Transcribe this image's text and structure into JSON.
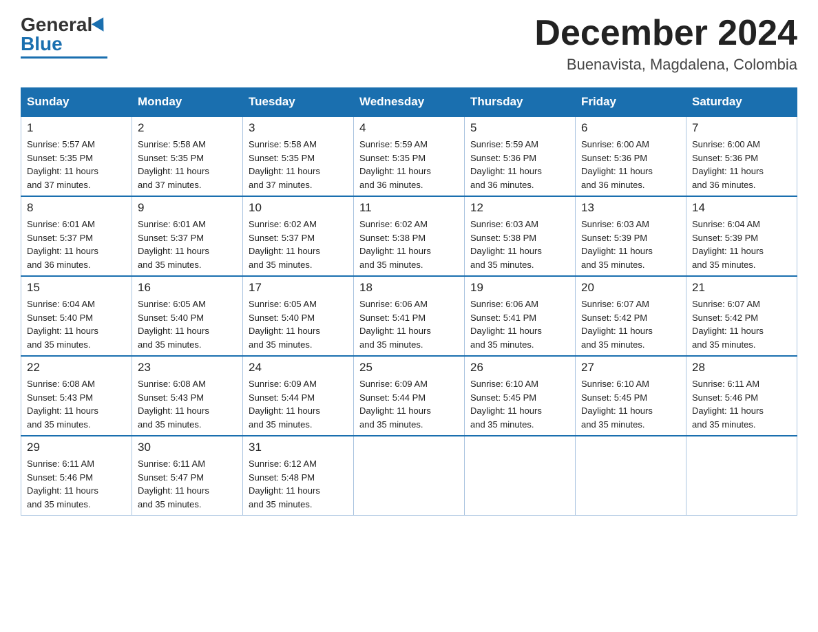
{
  "logo": {
    "general": "General",
    "blue": "Blue"
  },
  "title": "December 2024",
  "subtitle": "Buenavista, Magdalena, Colombia",
  "days_header": [
    "Sunday",
    "Monday",
    "Tuesday",
    "Wednesday",
    "Thursday",
    "Friday",
    "Saturday"
  ],
  "weeks": [
    [
      {
        "day": "1",
        "info": "Sunrise: 5:57 AM\nSunset: 5:35 PM\nDaylight: 11 hours\nand 37 minutes."
      },
      {
        "day": "2",
        "info": "Sunrise: 5:58 AM\nSunset: 5:35 PM\nDaylight: 11 hours\nand 37 minutes."
      },
      {
        "day": "3",
        "info": "Sunrise: 5:58 AM\nSunset: 5:35 PM\nDaylight: 11 hours\nand 37 minutes."
      },
      {
        "day": "4",
        "info": "Sunrise: 5:59 AM\nSunset: 5:35 PM\nDaylight: 11 hours\nand 36 minutes."
      },
      {
        "day": "5",
        "info": "Sunrise: 5:59 AM\nSunset: 5:36 PM\nDaylight: 11 hours\nand 36 minutes."
      },
      {
        "day": "6",
        "info": "Sunrise: 6:00 AM\nSunset: 5:36 PM\nDaylight: 11 hours\nand 36 minutes."
      },
      {
        "day": "7",
        "info": "Sunrise: 6:00 AM\nSunset: 5:36 PM\nDaylight: 11 hours\nand 36 minutes."
      }
    ],
    [
      {
        "day": "8",
        "info": "Sunrise: 6:01 AM\nSunset: 5:37 PM\nDaylight: 11 hours\nand 36 minutes."
      },
      {
        "day": "9",
        "info": "Sunrise: 6:01 AM\nSunset: 5:37 PM\nDaylight: 11 hours\nand 35 minutes."
      },
      {
        "day": "10",
        "info": "Sunrise: 6:02 AM\nSunset: 5:37 PM\nDaylight: 11 hours\nand 35 minutes."
      },
      {
        "day": "11",
        "info": "Sunrise: 6:02 AM\nSunset: 5:38 PM\nDaylight: 11 hours\nand 35 minutes."
      },
      {
        "day": "12",
        "info": "Sunrise: 6:03 AM\nSunset: 5:38 PM\nDaylight: 11 hours\nand 35 minutes."
      },
      {
        "day": "13",
        "info": "Sunrise: 6:03 AM\nSunset: 5:39 PM\nDaylight: 11 hours\nand 35 minutes."
      },
      {
        "day": "14",
        "info": "Sunrise: 6:04 AM\nSunset: 5:39 PM\nDaylight: 11 hours\nand 35 minutes."
      }
    ],
    [
      {
        "day": "15",
        "info": "Sunrise: 6:04 AM\nSunset: 5:40 PM\nDaylight: 11 hours\nand 35 minutes."
      },
      {
        "day": "16",
        "info": "Sunrise: 6:05 AM\nSunset: 5:40 PM\nDaylight: 11 hours\nand 35 minutes."
      },
      {
        "day": "17",
        "info": "Sunrise: 6:05 AM\nSunset: 5:40 PM\nDaylight: 11 hours\nand 35 minutes."
      },
      {
        "day": "18",
        "info": "Sunrise: 6:06 AM\nSunset: 5:41 PM\nDaylight: 11 hours\nand 35 minutes."
      },
      {
        "day": "19",
        "info": "Sunrise: 6:06 AM\nSunset: 5:41 PM\nDaylight: 11 hours\nand 35 minutes."
      },
      {
        "day": "20",
        "info": "Sunrise: 6:07 AM\nSunset: 5:42 PM\nDaylight: 11 hours\nand 35 minutes."
      },
      {
        "day": "21",
        "info": "Sunrise: 6:07 AM\nSunset: 5:42 PM\nDaylight: 11 hours\nand 35 minutes."
      }
    ],
    [
      {
        "day": "22",
        "info": "Sunrise: 6:08 AM\nSunset: 5:43 PM\nDaylight: 11 hours\nand 35 minutes."
      },
      {
        "day": "23",
        "info": "Sunrise: 6:08 AM\nSunset: 5:43 PM\nDaylight: 11 hours\nand 35 minutes."
      },
      {
        "day": "24",
        "info": "Sunrise: 6:09 AM\nSunset: 5:44 PM\nDaylight: 11 hours\nand 35 minutes."
      },
      {
        "day": "25",
        "info": "Sunrise: 6:09 AM\nSunset: 5:44 PM\nDaylight: 11 hours\nand 35 minutes."
      },
      {
        "day": "26",
        "info": "Sunrise: 6:10 AM\nSunset: 5:45 PM\nDaylight: 11 hours\nand 35 minutes."
      },
      {
        "day": "27",
        "info": "Sunrise: 6:10 AM\nSunset: 5:45 PM\nDaylight: 11 hours\nand 35 minutes."
      },
      {
        "day": "28",
        "info": "Sunrise: 6:11 AM\nSunset: 5:46 PM\nDaylight: 11 hours\nand 35 minutes."
      }
    ],
    [
      {
        "day": "29",
        "info": "Sunrise: 6:11 AM\nSunset: 5:46 PM\nDaylight: 11 hours\nand 35 minutes."
      },
      {
        "day": "30",
        "info": "Sunrise: 6:11 AM\nSunset: 5:47 PM\nDaylight: 11 hours\nand 35 minutes."
      },
      {
        "day": "31",
        "info": "Sunrise: 6:12 AM\nSunset: 5:48 PM\nDaylight: 11 hours\nand 35 minutes."
      },
      {
        "day": "",
        "info": ""
      },
      {
        "day": "",
        "info": ""
      },
      {
        "day": "",
        "info": ""
      },
      {
        "day": "",
        "info": ""
      }
    ]
  ]
}
